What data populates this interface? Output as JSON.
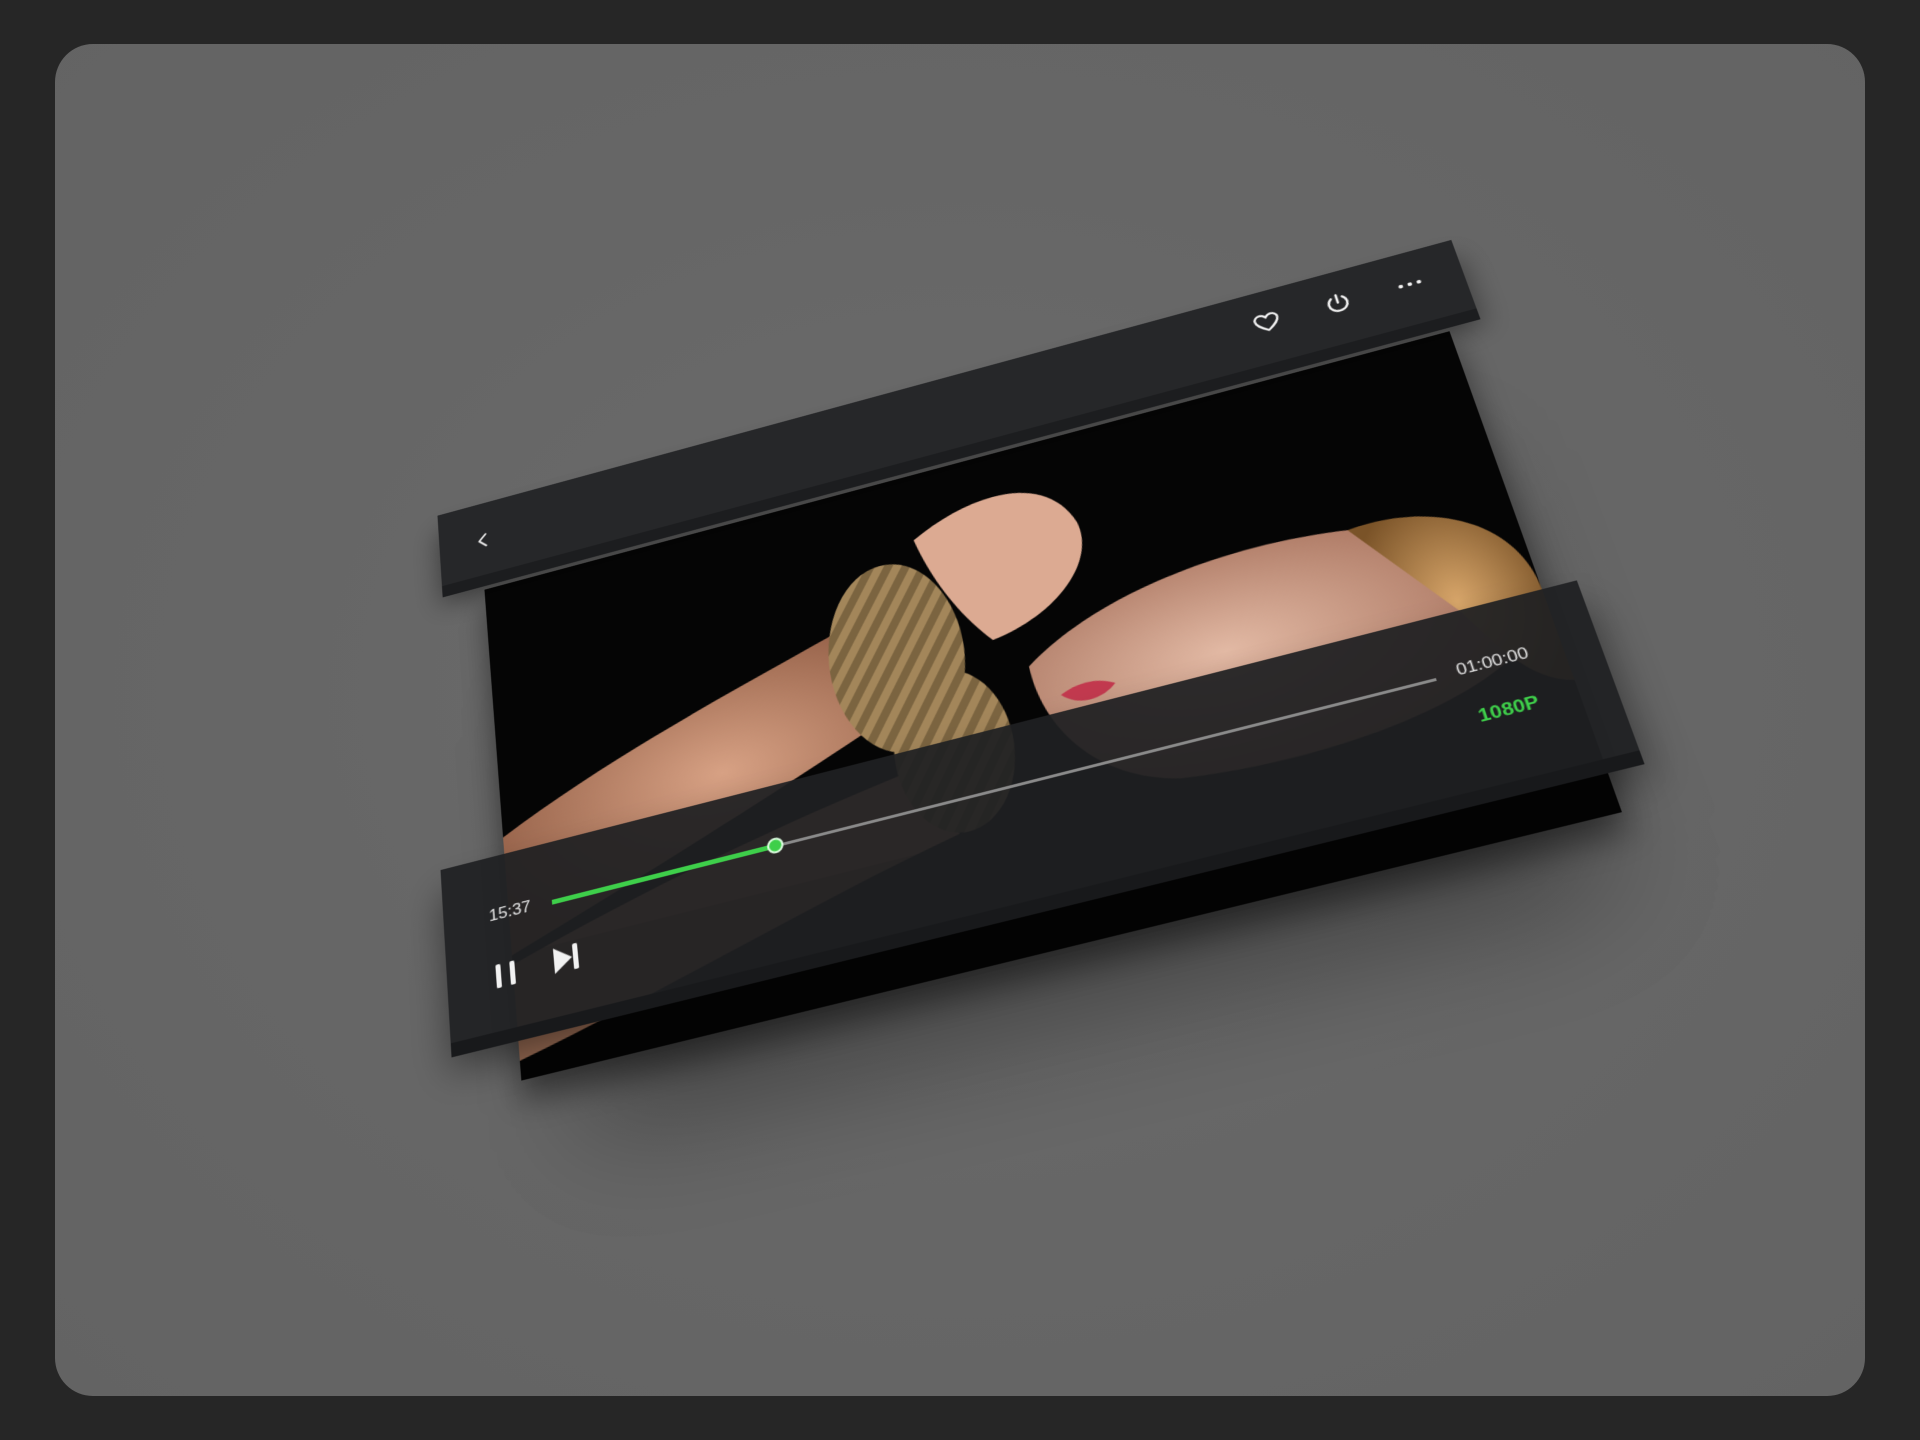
{
  "player": {
    "current_time": "15:37",
    "total_time": "01:00:00",
    "quality": "1080P",
    "progress": 0.26,
    "accent_color": "#3ecf4a"
  },
  "icons": {
    "back": "chevron-left-icon",
    "favorite": "heart-icon",
    "power": "power-icon",
    "more": "more-dots-icon",
    "pause": "pause-icon",
    "next": "skip-next-icon"
  }
}
